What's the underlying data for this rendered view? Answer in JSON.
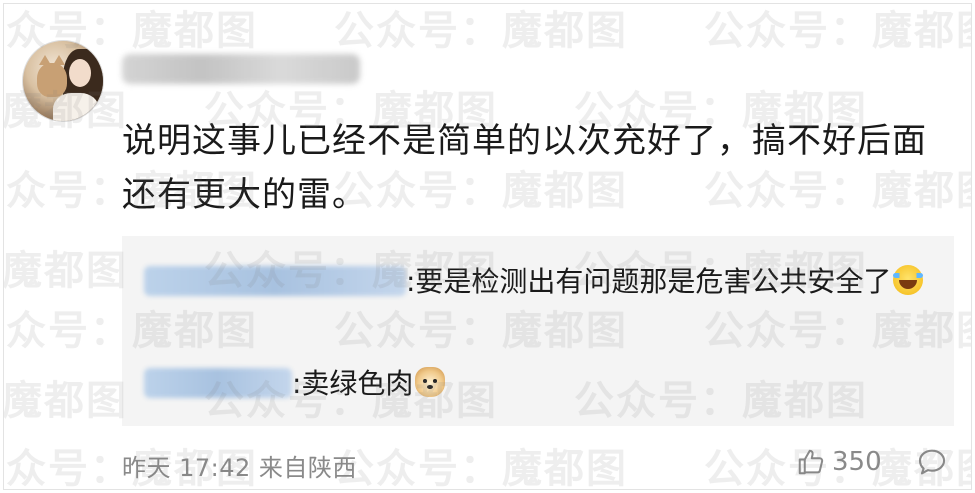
{
  "comment": {
    "text": "说明这事儿已经不是简单的以次充好了，搞不好后面还有更大的雷。",
    "time": "昨天 17:42 来自陕西",
    "like_count": "350"
  },
  "replies": [
    {
      "text": ":要是检测出有问题那是危害公共安全了",
      "emoji": "laugh-cry-icon"
    },
    {
      "text": ":卖绿色肉",
      "emoji": "doge-icon"
    }
  ],
  "watermark": {
    "text": "公众号：魔都图"
  },
  "colors": {
    "text": "#1a1a1a",
    "meta": "#8a8a8a",
    "reply_bg": "#f4f4f4",
    "watermark": "#bdbdbd"
  }
}
